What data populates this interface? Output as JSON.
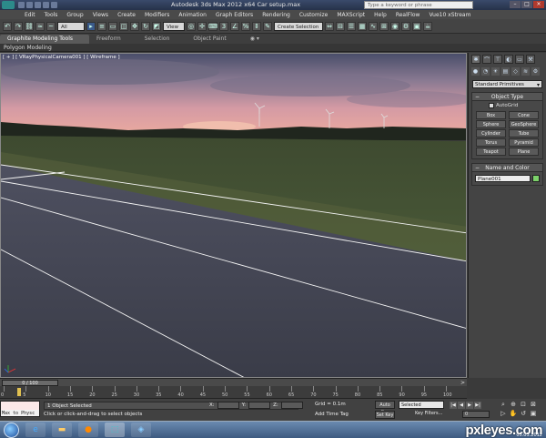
{
  "window": {
    "title": "Autodesk 3ds Max  2012 x64     Car setup.max",
    "search_placeholder": "Type a keyword or phrase"
  },
  "menu": [
    "Edit",
    "Tools",
    "Group",
    "Views",
    "Create",
    "Modifiers",
    "Animation",
    "Graph Editors",
    "Rendering",
    "Customize",
    "MAXScript",
    "Help",
    "RealFlow",
    "Vue10 xStream"
  ],
  "toolbar": {
    "selection_filter": "All",
    "reference_coord": "View",
    "named_selection": "Create Selection Set"
  },
  "ribbon": {
    "tabs": [
      "Graphite Modeling Tools",
      "Freeform",
      "Selection",
      "Object Paint"
    ],
    "sub_label": "Polygon Modeling"
  },
  "viewport": {
    "label": "[ + ] [ VRayPhysicalCamera001 ] [ Wireframe ]"
  },
  "command_panel": {
    "dropdown": "Standard Primitives",
    "object_type_title": "Object Type",
    "autogrid_label": "AutoGrid",
    "primitives": [
      "Box",
      "Cone",
      "Sphere",
      "GeoSphere",
      "Cylinder",
      "Tube",
      "Torus",
      "Pyramid",
      "Teapot",
      "Plane"
    ],
    "name_color_title": "Name and Color",
    "object_name": "Plane001",
    "object_color": "#7cd26a"
  },
  "timeline": {
    "slider_text": "0 / 100",
    "ticks": [
      "0",
      "5",
      "10",
      "15",
      "20",
      "25",
      "30",
      "35",
      "40",
      "45",
      "50",
      "55",
      "60",
      "65",
      "70",
      "75",
      "80",
      "85",
      "90",
      "95",
      "100"
    ]
  },
  "status": {
    "maxscript_text": "Max to Physc",
    "selection_text": "1 Object Selected",
    "prompt_text": "Click or click-and-drag to select objects",
    "x_label": "X:",
    "y_label": "Y:",
    "z_label": "Z:",
    "grid": "Grid = 0.1m",
    "time_tag": "Add Time Tag",
    "auto_key": "Auto Key",
    "set_key": "Set Key",
    "selected": "Selected",
    "key_filters": "Key Filters...",
    "frame": "0"
  },
  "taskbar": {
    "brand": "pxleyes.com",
    "clock": "05.03.2012"
  }
}
